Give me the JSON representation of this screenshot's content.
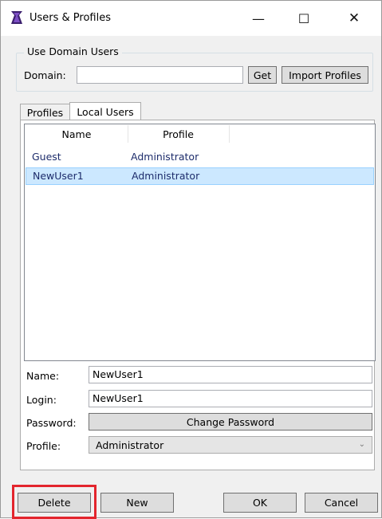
{
  "window": {
    "title": "Users & Profiles",
    "minimize_glyph": "—",
    "maximize_glyph": "☐",
    "close_glyph": "✕",
    "icon": "app-logo-icon"
  },
  "domain_group": {
    "legend": "Use Domain Users",
    "domain_label": "Domain:",
    "domain_value": "",
    "get_label": "Get",
    "import_label": "Import Profiles"
  },
  "tabs": [
    {
      "label": "Profiles",
      "active": false
    },
    {
      "label": "Local Users",
      "active": true
    }
  ],
  "table": {
    "columns": [
      "Name",
      "Profile"
    ],
    "rows": [
      {
        "name": "Guest",
        "profile": "Administrator",
        "selected": false
      },
      {
        "name": "NewUser1",
        "profile": "Administrator",
        "selected": true
      }
    ]
  },
  "form": {
    "name_label": "Name:",
    "name_value": "NewUser1",
    "login_label": "Login:",
    "login_value": "NewUser1",
    "password_label": "Password:",
    "change_password_label": "Change Password",
    "profile_label": "Profile:",
    "profile_value": "Administrator",
    "dropdown_glyph": "⌄"
  },
  "buttons": {
    "delete": "Delete",
    "new": "New",
    "ok": "OK",
    "cancel": "Cancel"
  },
  "colors": {
    "highlight": "#e3252d",
    "selection": "#cce8ff",
    "text_blue": "#1d2c6b"
  }
}
